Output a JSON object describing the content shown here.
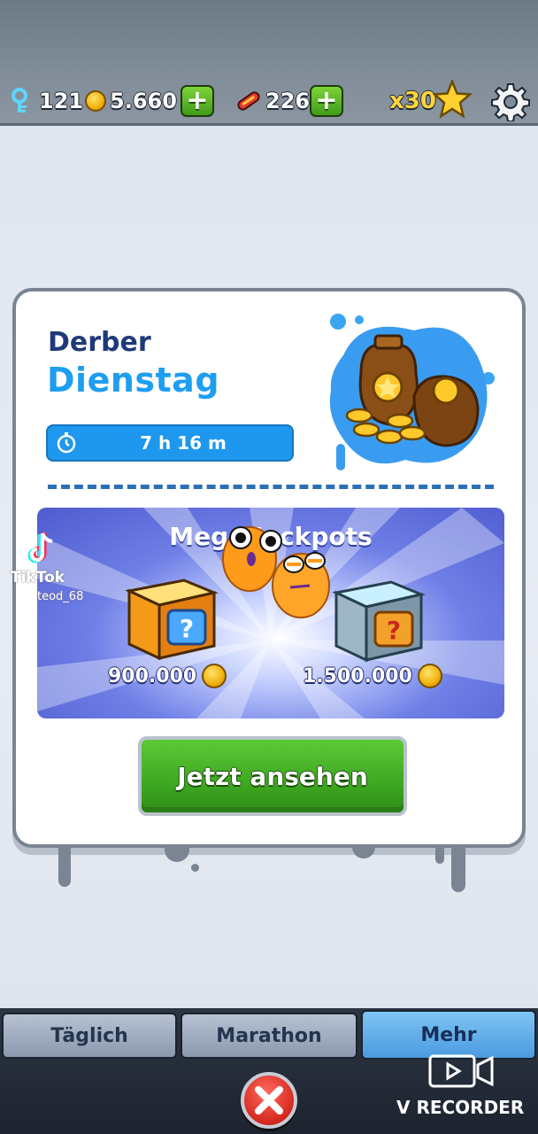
{
  "hud": {
    "keys": "121",
    "coins": "5.660",
    "boards": "226",
    "multiplier": "x30",
    "icons": [
      "key-icon",
      "coin-icon",
      "hoverboard-icon",
      "star-icon",
      "gear-icon"
    ]
  },
  "card": {
    "title_line1": "Derber",
    "title_line2": "Dienstag",
    "timer": "7 h 16 m",
    "jackpot_title": "Mega Jackpots",
    "prize_left": "900.000",
    "prize_right": "1.500.000",
    "watch_button": "Jetzt ansehen"
  },
  "overlay": {
    "tiktok_label": "TikTok",
    "tiktok_user": "teod_68",
    "recorder_label": "V RECORDER"
  },
  "tabs": [
    {
      "label": "Täglich",
      "active": false
    },
    {
      "label": "Marathon",
      "active": false
    },
    {
      "label": "Mehr",
      "active": true
    }
  ],
  "colors": {
    "title_dark": "#1f3a7a",
    "title_blue": "#1e9ef0",
    "timer_bg": "#1e98ee",
    "button_green": "#3ea821",
    "close_red": "#d92d22"
  }
}
